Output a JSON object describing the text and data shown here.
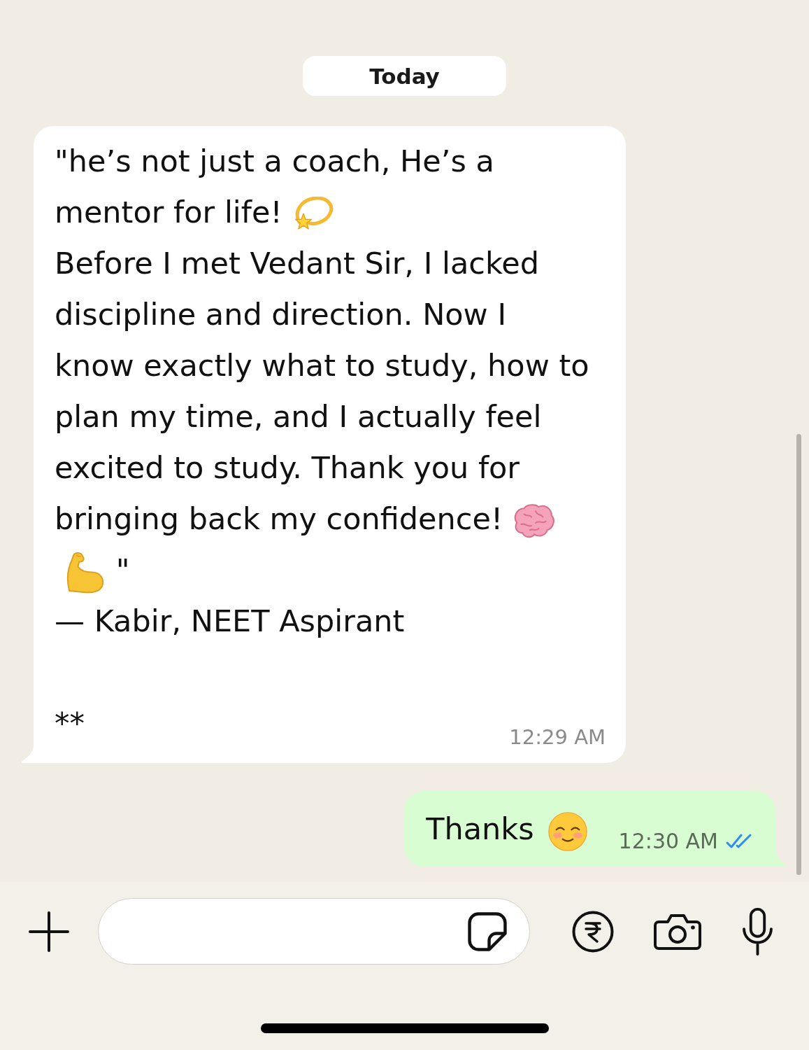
{
  "date_chip": {
    "label": "Today"
  },
  "messages": [
    {
      "kind": "incoming",
      "paragraphs": [
        [
          {
            "kind": "text",
            "text": "\"he’s not just a coach, He’s a"
          },
          {
            "kind": "text",
            "text": "mentor for life!"
          },
          {
            "kind": "dizzy"
          }
        ],
        [
          {
            "kind": "text",
            "text": "Before I met Vedant Sir, I lacked discipline and direction. Now I know exactly what to study, how to plan my time, and I actually feel excited to study. Thank you for"
          },
          {
            "kind": "text",
            "text": "bringing back my confidence!"
          },
          {
            "kind": "brain"
          },
          {
            "kind": "biceps"
          },
          {
            "kind": "text",
            "text": " \""
          }
        ],
        [
          {
            "kind": "text",
            "text": "— Kabir, NEET Aspirant\n\n**"
          }
        ]
      ],
      "time": "12:29 AM"
    },
    {
      "kind": "outgoing",
      "paragraphs": [
        [
          {
            "kind": "text",
            "text": "Thanks"
          },
          {
            "kind": "smile"
          }
        ]
      ],
      "time": "12:30 AM",
      "read": true
    }
  ]
}
